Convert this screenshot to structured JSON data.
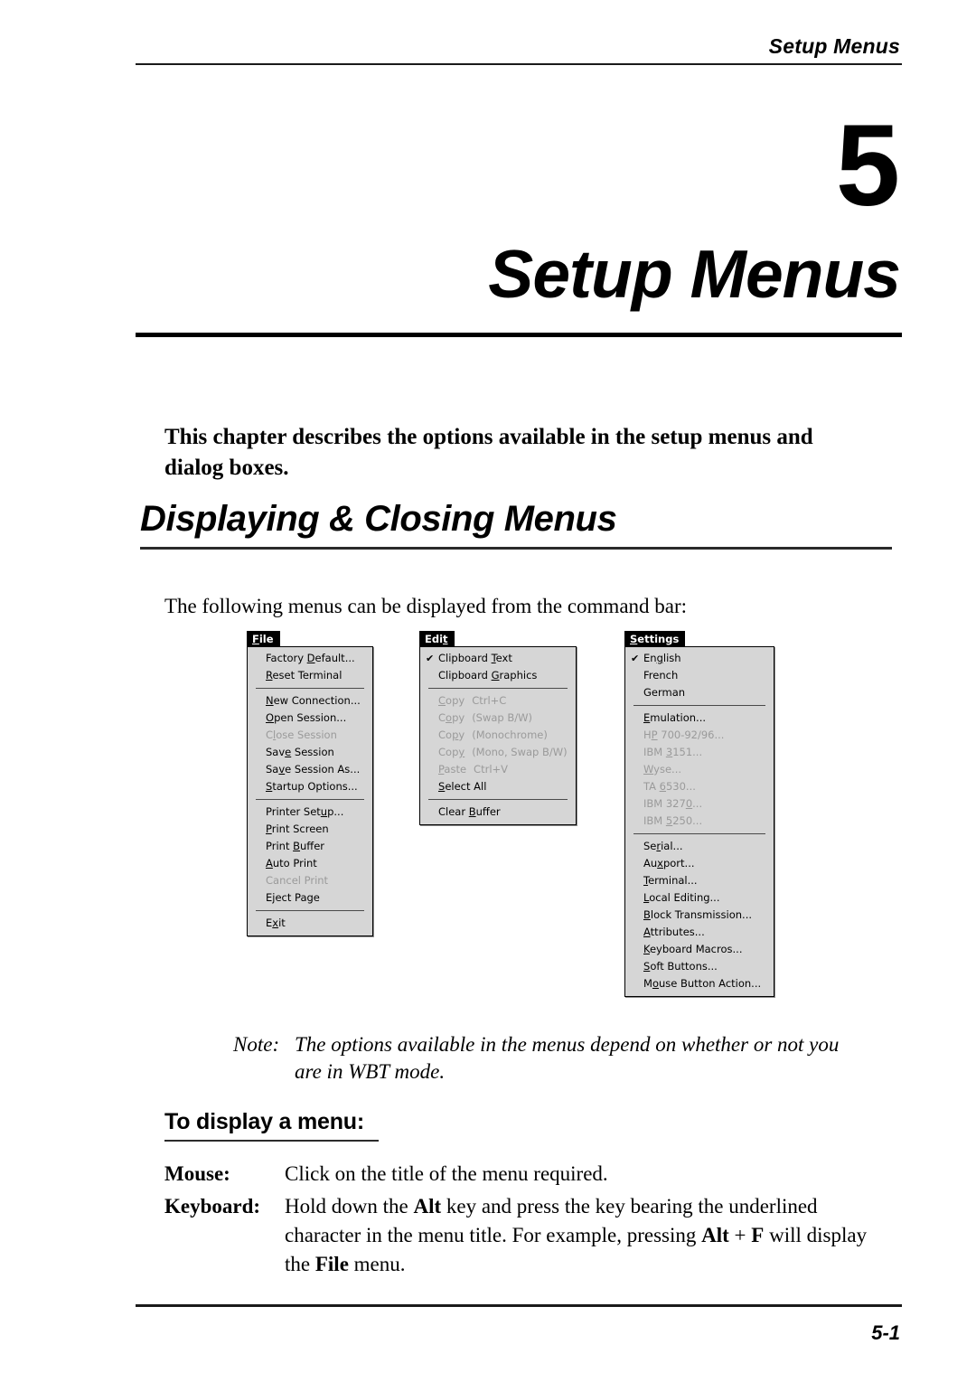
{
  "header": {
    "running_head": "Setup Menus"
  },
  "chapter": {
    "number": "5",
    "title": "Setup Menus"
  },
  "intro": {
    "text": "This chapter describes the options available in the setup menus and dialog boxes."
  },
  "section": {
    "title": "Displaying & Closing Menus",
    "body": "The following menus can be displayed from the command bar:"
  },
  "menus": [
    {
      "id": "file",
      "tab_label": "File",
      "tab_mnemonic": "F",
      "groups": [
        [
          {
            "label": "Factory Default...",
            "mnemonic": "D",
            "disabled": false,
            "checked": false
          },
          {
            "label": "Reset Terminal",
            "mnemonic": "R",
            "disabled": false,
            "checked": false
          }
        ],
        [
          {
            "label": "New Connection...",
            "mnemonic": "N",
            "disabled": false,
            "checked": false
          },
          {
            "label": "Open Session...",
            "mnemonic": "O",
            "disabled": false,
            "checked": false
          },
          {
            "label": "Close Session",
            "mnemonic": "l",
            "disabled": true,
            "checked": false
          },
          {
            "label": "Save Session",
            "mnemonic": "e",
            "disabled": false,
            "checked": false
          },
          {
            "label": "Save Session As...",
            "mnemonic": "v",
            "disabled": false,
            "checked": false
          },
          {
            "label": "Startup Options...",
            "mnemonic": "S",
            "disabled": false,
            "checked": false
          }
        ],
        [
          {
            "label": "Printer Setup...",
            "mnemonic": "u",
            "disabled": false,
            "checked": false
          },
          {
            "label": "Print Screen",
            "mnemonic": "P",
            "disabled": false,
            "checked": false
          },
          {
            "label": "Print Buffer",
            "mnemonic": "B",
            "disabled": false,
            "checked": false
          },
          {
            "label": "Auto Print",
            "mnemonic": "A",
            "disabled": false,
            "checked": false
          },
          {
            "label": "Cancel Print",
            "mnemonic": "",
            "disabled": true,
            "checked": false
          },
          {
            "label": "Eject Page",
            "mnemonic": "j",
            "disabled": false,
            "checked": false
          }
        ],
        [
          {
            "label": "Exit",
            "mnemonic": "x",
            "disabled": false,
            "checked": false
          }
        ]
      ]
    },
    {
      "id": "edit",
      "tab_label": "Edit",
      "tab_mnemonic": "t",
      "groups": [
        [
          {
            "label": "Clipboard Text",
            "mnemonic": "T",
            "disabled": false,
            "checked": true
          },
          {
            "label": "Clipboard Graphics",
            "mnemonic": "G",
            "disabled": false,
            "checked": false
          }
        ],
        [
          {
            "label": "Copy",
            "accel": "Ctrl+C",
            "mnemonic": "C",
            "disabled": true,
            "checked": false
          },
          {
            "label": "Copy",
            "accel": "(Swap B/W)",
            "mnemonic": "o",
            "disabled": true,
            "checked": false
          },
          {
            "label": "Copy",
            "accel": "(Monochrome)",
            "mnemonic": "p",
            "disabled": true,
            "checked": false
          },
          {
            "label": "Copy",
            "accel": "(Mono, Swap B/W)",
            "mnemonic": "y",
            "disabled": true,
            "checked": false
          },
          {
            "label": "Paste",
            "accel": "Ctrl+V",
            "mnemonic": "P",
            "disabled": true,
            "checked": false
          },
          {
            "label": "Select All",
            "mnemonic": "S",
            "disabled": false,
            "checked": false
          }
        ],
        [
          {
            "label": "Clear Buffer",
            "mnemonic": "B",
            "disabled": false,
            "checked": false
          }
        ]
      ]
    },
    {
      "id": "settings",
      "tab_label": "Settings",
      "tab_mnemonic": "S",
      "groups": [
        [
          {
            "label": "English",
            "mnemonic": "g",
            "disabled": false,
            "checked": true
          },
          {
            "label": "French",
            "mnemonic": "",
            "disabled": false,
            "checked": false
          },
          {
            "label": "German",
            "mnemonic": "",
            "disabled": false,
            "checked": false
          }
        ],
        [
          {
            "label": "Emulation...",
            "mnemonic": "E",
            "disabled": false,
            "checked": false
          },
          {
            "label": "HP 700-92/96...",
            "mnemonic": "P",
            "disabled": true,
            "checked": false
          },
          {
            "label": "IBM 3151...",
            "mnemonic": "3",
            "disabled": true,
            "checked": false
          },
          {
            "label": "Wyse...",
            "mnemonic": "W",
            "disabled": true,
            "checked": false
          },
          {
            "label": "TA 6530...",
            "mnemonic": "6",
            "disabled": true,
            "checked": false
          },
          {
            "label": "IBM 3270...",
            "mnemonic": "0",
            "disabled": true,
            "checked": false
          },
          {
            "label": "IBM 5250...",
            "mnemonic": "5",
            "disabled": true,
            "checked": false
          }
        ],
        [
          {
            "label": "Serial...",
            "mnemonic": "r",
            "disabled": false,
            "checked": false
          },
          {
            "label": "Auxport...",
            "mnemonic": "x",
            "disabled": false,
            "checked": false
          },
          {
            "label": "Terminal...",
            "mnemonic": "T",
            "disabled": false,
            "checked": false
          },
          {
            "label": "Local Editing...",
            "mnemonic": "L",
            "disabled": false,
            "checked": false
          },
          {
            "label": "Block Transmission...",
            "mnemonic": "B",
            "disabled": false,
            "checked": false
          },
          {
            "label": "Attributes...",
            "mnemonic": "A",
            "disabled": false,
            "checked": false
          },
          {
            "label": "Keyboard Macros...",
            "mnemonic": "K",
            "disabled": false,
            "checked": false
          },
          {
            "label": "Soft Buttons...",
            "mnemonic": "S",
            "disabled": false,
            "checked": false
          },
          {
            "label": "Mouse Button Action...",
            "mnemonic": "o",
            "disabled": false,
            "checked": false
          }
        ]
      ]
    }
  ],
  "note": {
    "label": "Note:",
    "text": "The options available in the menus depend on whether or not you are in WBT mode."
  },
  "subsection": {
    "title": "To display a menu:"
  },
  "instructions": [
    {
      "term": "Mouse:",
      "definition": "Click on the title of the menu required."
    },
    {
      "term": "Keyboard:",
      "definition": "Hold down the Alt key and press the key bearing the underlined character in the menu title. For example, pressing Alt + F will display the File menu."
    }
  ],
  "footer": {
    "page_number": "5-1"
  },
  "icons": {
    "checkmark": "✔"
  }
}
